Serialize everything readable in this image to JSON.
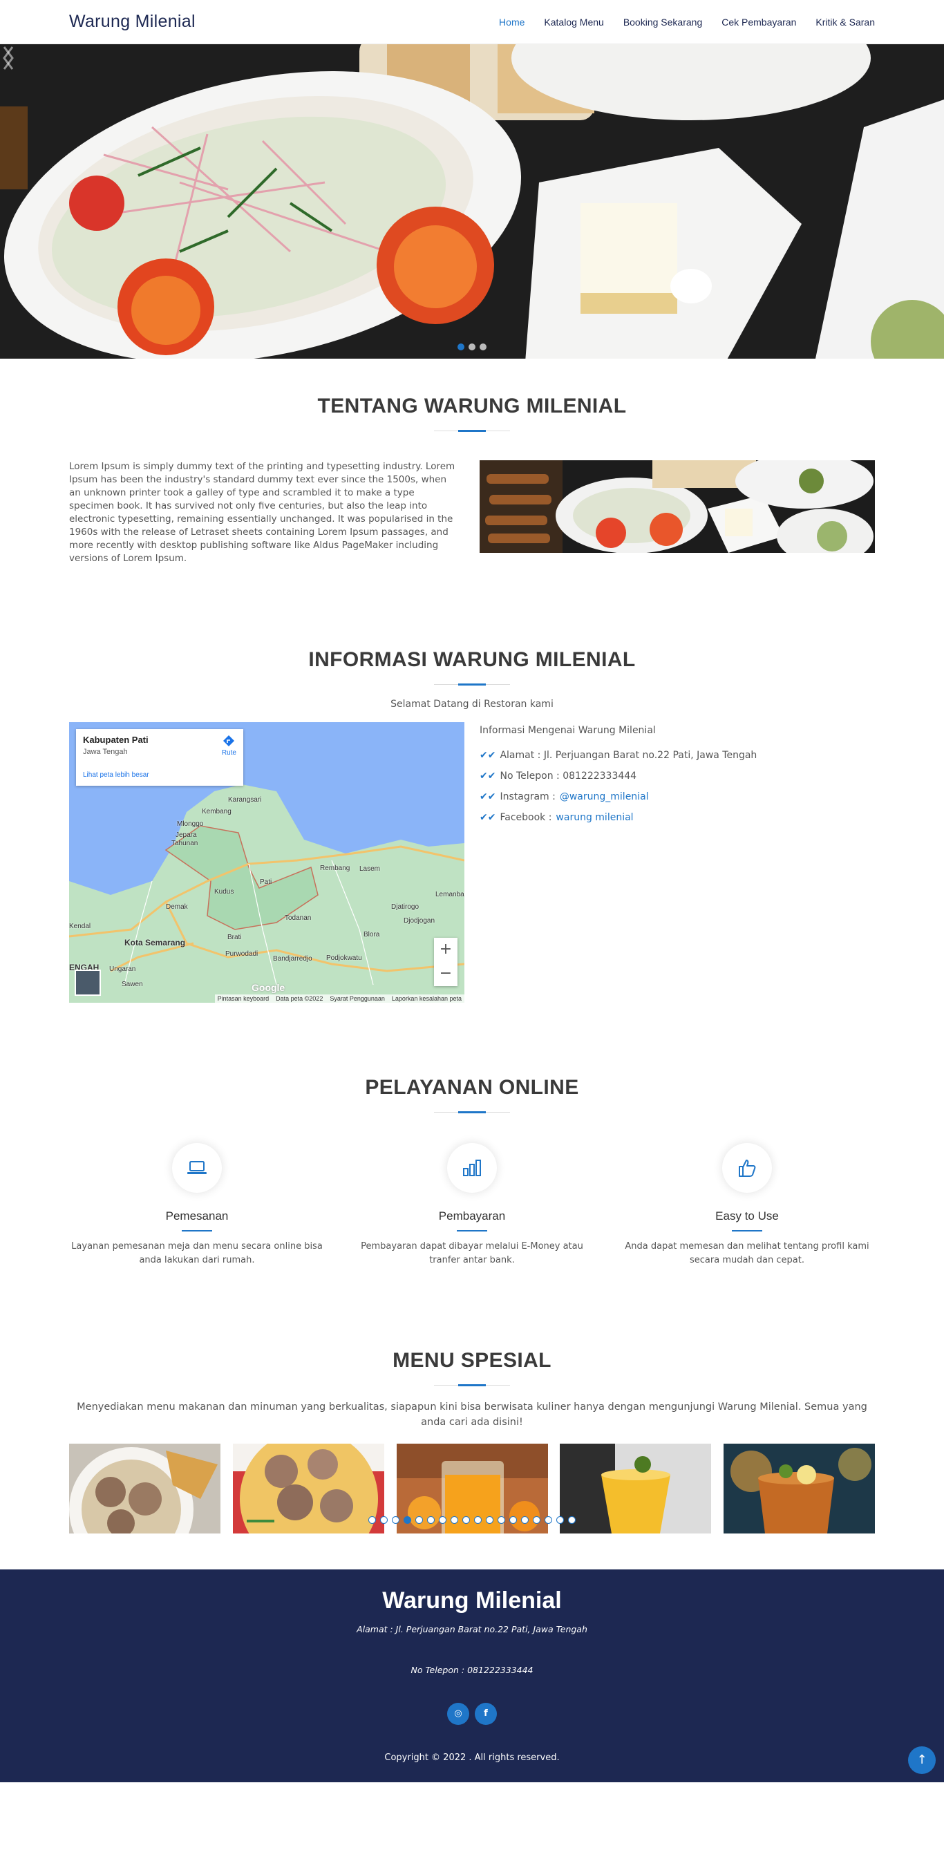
{
  "header": {
    "logo": "Warung Milenial",
    "nav": [
      "Home",
      "Katalog Menu",
      "Booking Sekarang",
      "Cek Pembayaran",
      "Kritik & Saran"
    ]
  },
  "hero": {
    "slides": 3,
    "active_slide": 1
  },
  "about": {
    "title": "TENTANG WARUNG MILENIAL",
    "text": "Lorem Ipsum is simply dummy text of the printing and typesetting industry. Lorem Ipsum has been the industry's standard dummy text ever since the 1500s, when an unknown printer took a galley of type and scrambled it to make a type specimen book. It has survived not only five centuries, but also the leap into electronic typesetting, remaining essentially unchanged. It was popularised in the 1960s with the release of Letraset sheets containing Lorem Ipsum passages, and more recently with desktop publishing software like Aldus PageMaker including versions of Lorem Ipsum."
  },
  "info": {
    "title": "INFORMASI WARUNG MILENIAL",
    "subtitle": "Selamat Datang di Restoran kami",
    "heading": "Informasi Mengenai Warung Milenial",
    "address": "Alamat : Jl. Perjuangan Barat no.22 Pati, Jawa Tengah",
    "phone": "No Telepon : 081222333444",
    "instagram_label": "Instagram : ",
    "instagram": "@warung_milenial",
    "facebook_label": "Facebook : ",
    "facebook": "warung milenial",
    "map": {
      "place": "Kabupaten Pati",
      "region": "Jawa Tengah",
      "route": "Rute",
      "bigger": "Lihat peta lebih besar",
      "google": "Google",
      "footer": [
        "Pintasan keyboard",
        "Data peta ©2022",
        "Syarat Penggunaan",
        "Laporkan kesalahan peta"
      ],
      "labels": [
        "Karangsari",
        "Kembang",
        "Mlonggo",
        "Jepara",
        "Tahunan",
        "Pati",
        "Rembang",
        "Lasem",
        "Kudus",
        "Demak",
        "Lemanbang",
        "Djatirogo",
        "Djodjogan",
        "Blora",
        "Todanan",
        "Kota Semarang",
        "Brati",
        "Purwodadi",
        "Bandjarredjo",
        "Podjokwatu",
        "Ungaran",
        "Sawen",
        "Kendal",
        "ENGAH"
      ]
    }
  },
  "services": {
    "title": "PELAYANAN ONLINE",
    "items": [
      {
        "icon": "laptop-icon",
        "title": "Pemesanan",
        "text": "Layanan pemesanan meja dan menu secara online bisa anda lakukan dari rumah."
      },
      {
        "icon": "bar-chart-icon",
        "title": "Pembayaran",
        "text": "Pembayaran dapat dibayar melalui E-Money atau tranfer antar bank."
      },
      {
        "icon": "thumbs-up-icon",
        "title": "Easy to Use",
        "text": "Anda dapat memesan dan melihat tentang profil kami secara mudah dan cepat."
      }
    ]
  },
  "menu": {
    "title": "MENU SPESIAL",
    "subtitle": "Menyediakan menu makanan dan minuman yang berkualitas, siapapun kini bisa berwisata kuliner hanya dengan mengunjungi Warung Milenial. Semua yang anda cari ada disini!",
    "pages": 18,
    "active_page": 4
  },
  "footer": {
    "title": "Warung Milenial",
    "address": "Alamat : Jl. Perjuangan Barat no.22 Pati, Jawa Tengah",
    "phone": "No Telepon : 081222333444",
    "copyright": "Copyright © 2022 . All rights reserved."
  },
  "colors": {
    "primary": "#1f76c8",
    "navy": "#1d2852"
  }
}
